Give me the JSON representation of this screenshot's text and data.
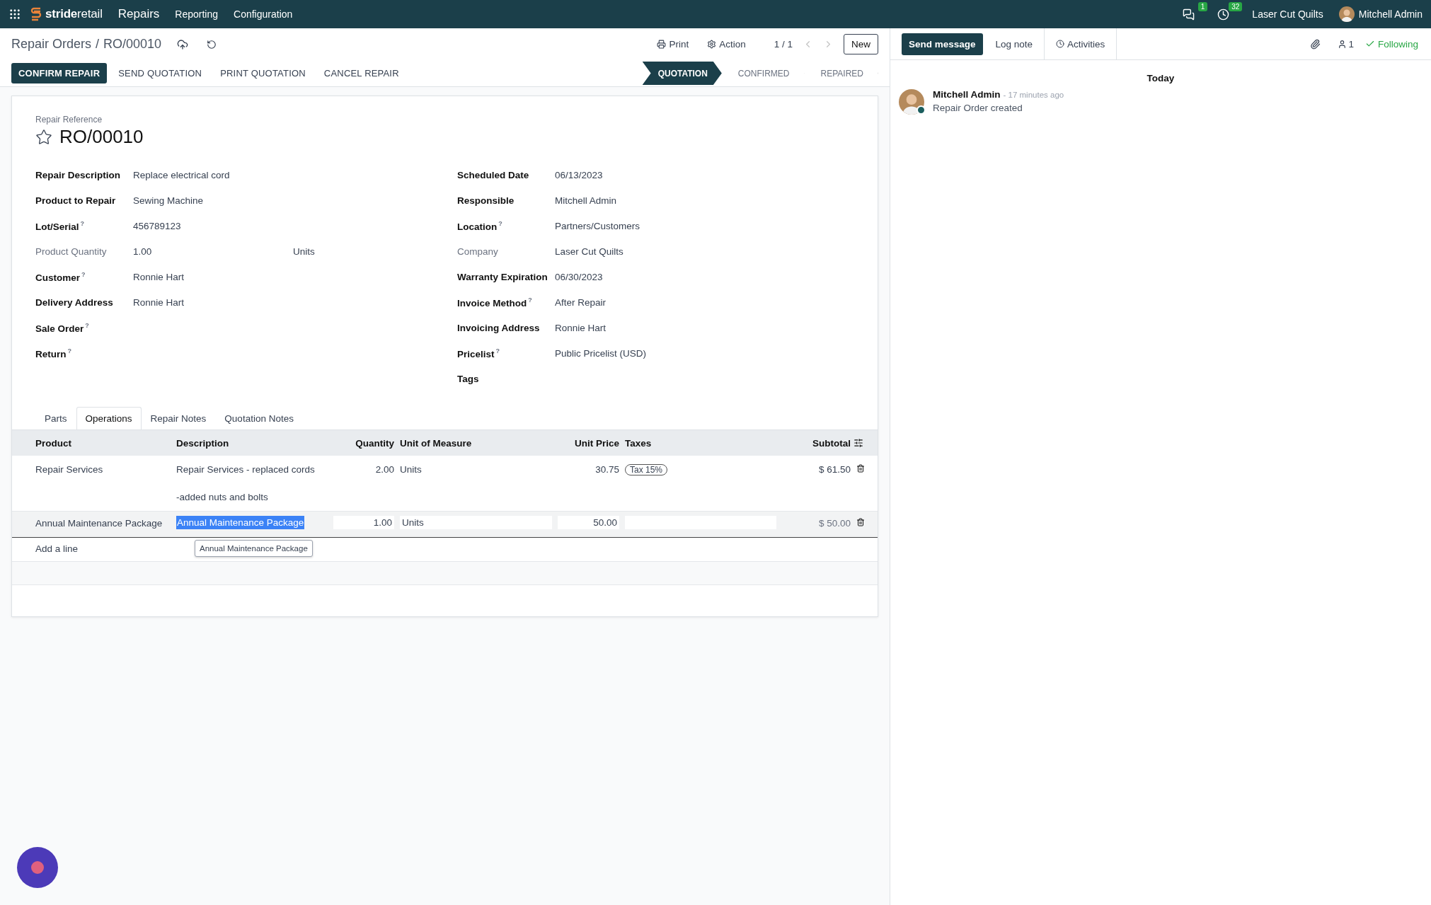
{
  "navbar": {
    "brand": "**stride**retail",
    "app_name": "Repairs",
    "menu": [
      "Reporting",
      "Configuration"
    ],
    "messages_count": "1",
    "activities_count": "32",
    "company": "Laser Cut Quilts",
    "user": "Mitchell Admin"
  },
  "breadcrumb": {
    "parent": "Repair Orders",
    "separator": "/",
    "current": "RO/00010"
  },
  "toolbar": {
    "print": "Print",
    "action": "Action",
    "pager": "1 / 1",
    "new": "New"
  },
  "actions": [
    {
      "label": "CONFIRM REPAIR",
      "kind": "primary"
    },
    {
      "label": "SEND QUOTATION",
      "kind": "secondary"
    },
    {
      "label": "PRINT QUOTATION",
      "kind": "secondary"
    },
    {
      "label": "CANCEL REPAIR",
      "kind": "secondary"
    }
  ],
  "stages": [
    {
      "label": "QUOTATION",
      "selected": true
    },
    {
      "label": "CONFIRMED",
      "selected": false
    },
    {
      "label": "REPAIRED",
      "selected": false
    }
  ],
  "form": {
    "reference_label": "Repair Reference",
    "reference": "RO/00010",
    "starred": false,
    "left_fields": [
      {
        "label": "Repair Description",
        "value": "Replace electrical cord",
        "readonly": false
      },
      {
        "label": "Product to Repair",
        "value": "Sewing Machine",
        "readonly": false
      },
      {
        "label": "Lot/Serial",
        "hint": "?",
        "value": "456789123",
        "readonly": false
      },
      {
        "label": "Product Quantity",
        "value": "1.00",
        "unit": "Units",
        "readonly": true
      },
      {
        "label": "Customer",
        "hint": "?",
        "value": "Ronnie Hart",
        "readonly": false
      },
      {
        "label": "Delivery Address",
        "value": "Ronnie Hart",
        "readonly": false
      },
      {
        "label": "Sale Order",
        "hint": "?",
        "readonly": false
      },
      {
        "label": "Return",
        "hint": "?",
        "readonly": false
      }
    ],
    "right_fields": [
      {
        "label": "Scheduled Date",
        "value": "06/13/2023",
        "readonly": false
      },
      {
        "label": "Responsible",
        "value": "Mitchell Admin",
        "readonly": false
      },
      {
        "label": "Location",
        "hint": "?",
        "value": "Partners/Customers",
        "readonly": false
      },
      {
        "label": "Company",
        "value": "Laser Cut Quilts",
        "readonly": true
      },
      {
        "label": "Warranty Expiration",
        "value": "06/30/2023",
        "readonly": false
      },
      {
        "label": "Invoice Method",
        "hint": "?",
        "value": "After Repair",
        "readonly": false
      },
      {
        "label": "Invoicing Address",
        "value": "Ronnie Hart",
        "readonly": false
      },
      {
        "label": "Pricelist",
        "hint": "?",
        "value": "Public Pricelist (USD)",
        "readonly": false
      },
      {
        "label": "Tags",
        "readonly": false
      }
    ]
  },
  "tabs": [
    {
      "label": "Parts",
      "selected": false
    },
    {
      "label": "Operations",
      "selected": true
    },
    {
      "label": "Repair Notes",
      "selected": false
    },
    {
      "label": "Quotation Notes",
      "selected": false
    }
  ],
  "table": {
    "columns": [
      "Product",
      "Description",
      "Quantity",
      "Unit of Measure",
      "Unit Price",
      "Taxes",
      "Subtotal"
    ],
    "rows": [
      {
        "product": "Repair Services",
        "description": "Repair Services - replaced cords",
        "note": "-added nuts and bolts",
        "quantity": "2.00",
        "uom": "Units",
        "unit_price": "30.75",
        "taxes": [
          "Tax 15%"
        ],
        "subtotal": "$ 61.50",
        "editing": false
      },
      {
        "product": "Annual Maintenance Package",
        "description": "Annual Maintenance Package",
        "quantity": "1.00",
        "uom": "Units",
        "unit_price": "50.00",
        "subtotal": "$ 50.00",
        "editing": true
      }
    ],
    "add_line": "Add a line",
    "tooltip": "Annual Maintenance Package"
  },
  "chatter": {
    "send": "Send message",
    "log": "Log note",
    "activities": "Activities",
    "followers": "1",
    "following": "Following",
    "date_separator": "Today",
    "messages": [
      {
        "author": "Mitchell Admin",
        "time": "- 17 minutes ago",
        "body": "Repair Order created",
        "online": true
      }
    ]
  }
}
